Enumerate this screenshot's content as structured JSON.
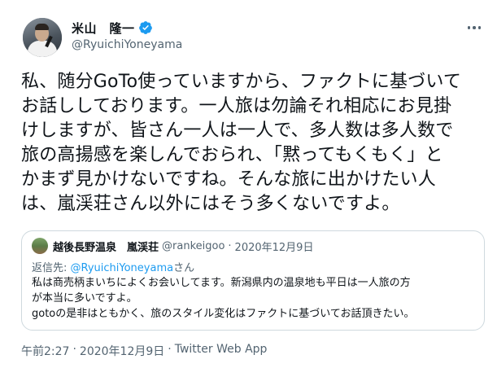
{
  "author": {
    "display_name": "米山　隆一",
    "handle": "@RyuichiYoneyama",
    "verified_icon": "verified-badge-icon",
    "more_icon": "more-options-icon"
  },
  "tweet": {
    "lines": [
      "私、随分GoTo使っていますから、ファクトに基づいて",
      "お話ししております。一人旅は勿論それ相応にお見掛",
      "けしますが、皆さん一人は一人で、多人数は多人数で",
      "旅の高揚感を楽しんでおられ、「黙ってもくもく」と",
      "かまず見かけないですね。そんな旅に出かけたい人",
      "は、嵐渓荘さん以外にはそう多くないですよ。"
    ]
  },
  "quote": {
    "name": "越後長野温泉　嵐渓荘",
    "handle": "@rankeigoo",
    "separator": "·",
    "date": "2020年12月9日",
    "reply_prefix": "返信先: ",
    "reply_mention": "@RyuichiYoneyama",
    "reply_suffix": "さん",
    "lines": [
      "私は商売柄まいちによくお会いしてます。新潟県内の温泉地も平日は一人旅の方",
      "が本当に多いですよ。",
      "gotoの是非はともかく、旅のスタイル変化はファクトに基づいてお話頂きたい。"
    ]
  },
  "meta": {
    "time": "午前2:27",
    "sep1": "·",
    "date": "2020年12月9日",
    "sep2": "·",
    "client": "Twitter Web App"
  },
  "colors": {
    "text": "#0f1419",
    "secondary": "#536471",
    "accent": "#1d9bf0",
    "border": "#cfd9de"
  }
}
